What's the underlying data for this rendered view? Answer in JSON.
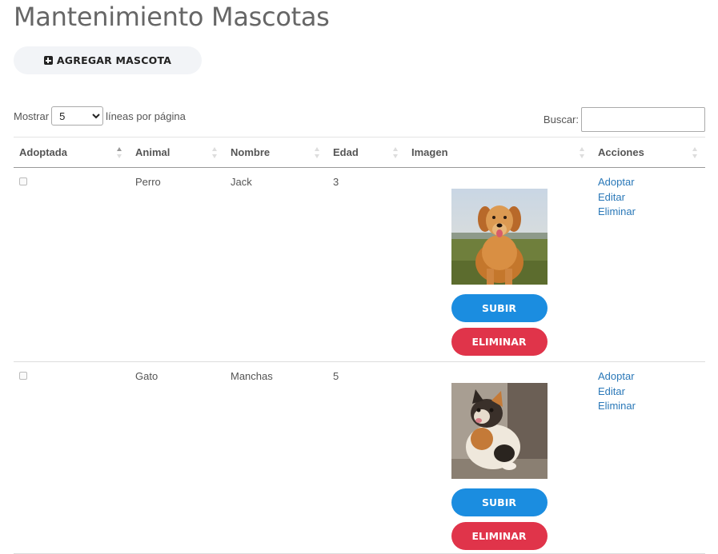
{
  "page": {
    "title": "Mantenimiento Mascotas"
  },
  "toolbar": {
    "add_label": "AGREGAR MASCOTA"
  },
  "length": {
    "prefix": "Mostrar",
    "value": "5",
    "suffix": "líneas por página"
  },
  "search": {
    "label": "Buscar:",
    "value": ""
  },
  "table": {
    "headers": [
      "Adoptada",
      "Animal",
      "Nombre",
      "Edad",
      "Imagen",
      "Acciones"
    ],
    "rows": [
      {
        "adopted": false,
        "animal": "Perro",
        "name": "Jack",
        "age": "3",
        "image": "dog-photo",
        "upload": "SUBIR",
        "delete_image": "ELIMINAR",
        "actions": [
          "Adoptar",
          "Editar",
          "Eliminar"
        ]
      },
      {
        "adopted": false,
        "animal": "Gato",
        "name": "Manchas",
        "age": "5",
        "image": "cat-photo",
        "upload": "SUBIR",
        "delete_image": "ELIMINAR",
        "actions": [
          "Adoptar",
          "Editar",
          "Eliminar"
        ]
      }
    ]
  },
  "colors": {
    "upload_button": "#1b8de0",
    "delete_button": "#e0344a",
    "link": "#2a78b8"
  }
}
